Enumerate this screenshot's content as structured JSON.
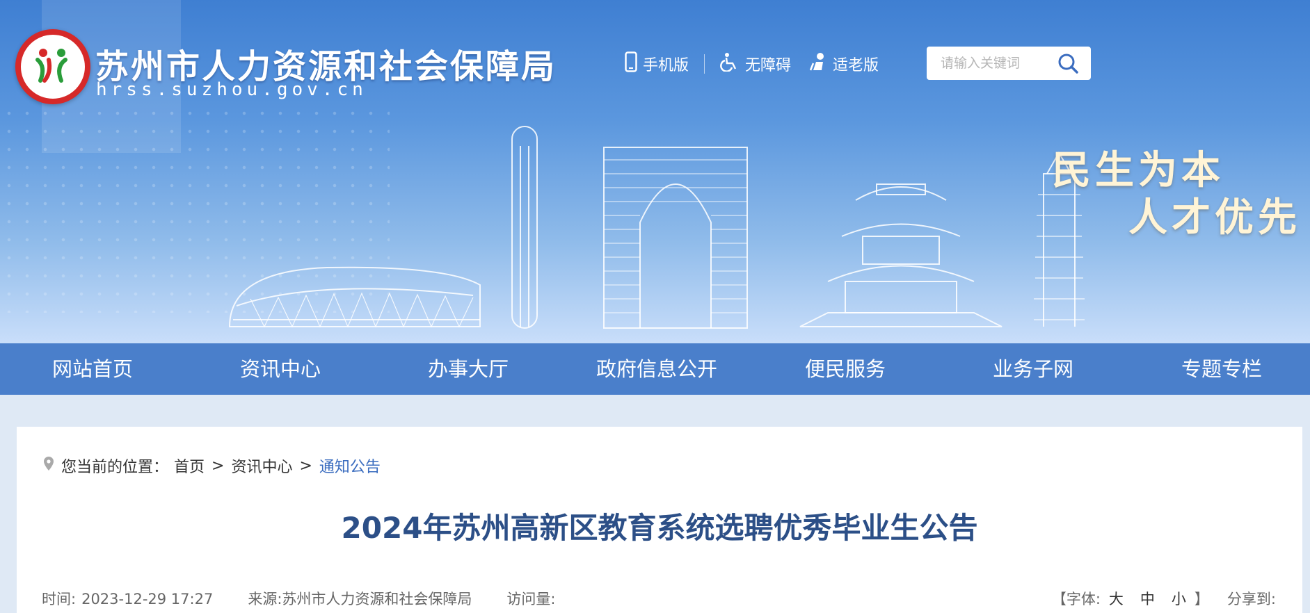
{
  "header": {
    "site_title": "苏州市人力资源和社会保障局",
    "site_domain": "hrss.suzhou.gov.cn",
    "links": [
      {
        "label": "手机版",
        "icon": "mobile-icon"
      },
      {
        "label": "无障碍",
        "icon": "accessibility-icon"
      },
      {
        "label": "适老版",
        "icon": "elderly-icon"
      }
    ],
    "search": {
      "placeholder": "请输入关键词",
      "icon": "search-icon"
    },
    "slogan_line1": "民生为本",
    "slogan_line2": "人才优先"
  },
  "nav": {
    "items": [
      {
        "label": "网站首页"
      },
      {
        "label": "资讯中心"
      },
      {
        "label": "办事大厅"
      },
      {
        "label": "政府信息公开"
      },
      {
        "label": "便民服务"
      },
      {
        "label": "业务子网"
      },
      {
        "label": "专题专栏"
      }
    ]
  },
  "breadcrumb": {
    "prefix": "您当前的位置：",
    "items": [
      {
        "label": "首页"
      },
      {
        "label": "资讯中心"
      },
      {
        "label": "通知公告"
      }
    ],
    "separator": ">"
  },
  "article": {
    "title": "2024年苏州高新区教育系统选聘优秀毕业生公告",
    "time_label": "时间:",
    "time_value": "2023-12-29 17:27",
    "source_label": "来源:",
    "source_value": "苏州市人力资源和社会保障局",
    "visits_label": "访问量:",
    "font_label": "【字体:",
    "font_large": "大",
    "font_medium": "中",
    "font_small": "小",
    "font_close": "】",
    "share_label": "分享到:"
  },
  "colors": {
    "nav_bg": "#4a7fcb",
    "title": "#2c4f87",
    "current_crumb": "#3a6cbf",
    "logo_ring": "#d62929"
  }
}
